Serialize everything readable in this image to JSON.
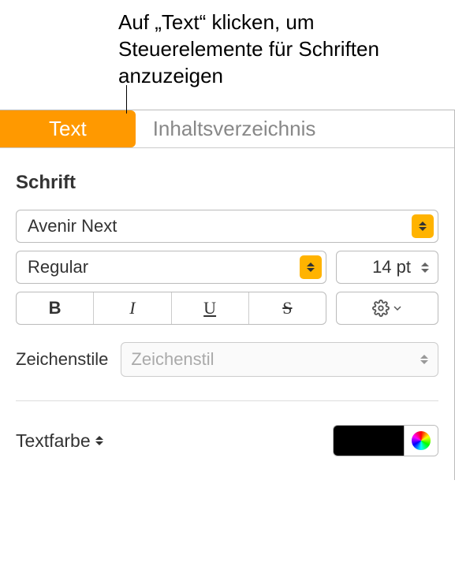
{
  "callout": "Auf „Text“ klicken, um Steuerelemente für Schriften anzuzeigen",
  "tabs": {
    "text": "Text",
    "toc": "Inhaltsverzeichnis"
  },
  "font": {
    "section_title": "Schrift",
    "family": "Avenir Next",
    "typeface": "Regular",
    "size": "14 pt",
    "bold": "B",
    "italic": "I",
    "underline": "U",
    "strike": "S"
  },
  "charstyle": {
    "label": "Zeichenstile",
    "placeholder": "Zeichenstil"
  },
  "textcolor": {
    "label": "Textfarbe",
    "value": "#000000"
  }
}
